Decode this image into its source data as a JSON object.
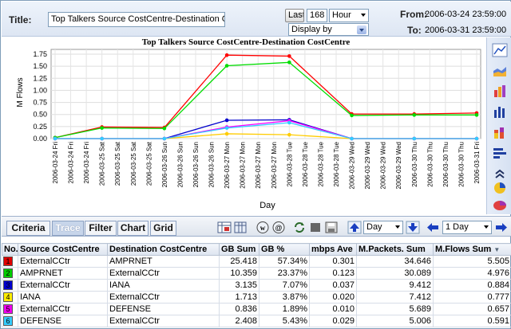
{
  "header": {
    "title_label": "Title:",
    "title_value": "Top Talkers Source CostCentre-Destination CostCentre",
    "last_label": "Last",
    "last_value": "168",
    "unit_value": "Hour",
    "display_by": "Display by",
    "from_label": "From:",
    "from_value": "2006-03-24 23:59:00",
    "to_label": "To:",
    "to_value": "2006-03-31 23:59:00"
  },
  "chart_data": {
    "type": "line",
    "title": "Top Talkers Source CostCentre-Destination CostCentre",
    "xlabel": "Day",
    "ylabel": "M Flows",
    "ylim": [
      0,
      1.75
    ],
    "yticks": [
      "0.00",
      "0.25",
      "0.50",
      "0.75",
      "1.00",
      "1.25",
      "1.50",
      "1.75"
    ],
    "categories": [
      "2006-03-24 Fri",
      "2006-03-24 Fri",
      "2006-03-24 Fri",
      "2006-03-25 Sat",
      "2006-03-25 Sat",
      "2006-03-25 Sat",
      "2006-03-25 Sat",
      "2006-03-26 Sun",
      "2006-03-26 Sun",
      "2006-03-26 Sun",
      "2006-03-26 Sun",
      "2006-03-27 Mon",
      "2006-03-27 Mon",
      "2006-03-27 Mon",
      "2006-03-27 Mon",
      "2006-03-28 Tue",
      "2006-03-28 Tue",
      "2006-03-28 Tue",
      "2006-03-28 Tue",
      "2006-03-29 Wed",
      "2006-03-29 Wed",
      "2006-03-29 Wed",
      "2006-03-29 Wed",
      "2006-03-30 Thu",
      "2006-03-30 Thu",
      "2006-03-30 Thu",
      "2006-03-30 Thu",
      "2006-03-31 Fri"
    ],
    "grid": true,
    "series": [
      {
        "color": "#ff0000",
        "points": [
          [
            0,
            0.02
          ],
          [
            3,
            0.24
          ],
          [
            7,
            0.23
          ],
          [
            11,
            1.73
          ],
          [
            15,
            1.71
          ],
          [
            19,
            0.51
          ],
          [
            23,
            0.51
          ],
          [
            27,
            0.53
          ]
        ]
      },
      {
        "color": "#00dd00",
        "points": [
          [
            0,
            0.02
          ],
          [
            3,
            0.22
          ],
          [
            7,
            0.21
          ],
          [
            11,
            1.51
          ],
          [
            15,
            1.58
          ],
          [
            19,
            0.48
          ],
          [
            23,
            0.49
          ],
          [
            27,
            0.49
          ]
        ]
      },
      {
        "color": "#0000cc",
        "points": [
          [
            0,
            0.0
          ],
          [
            3,
            0.0
          ],
          [
            7,
            0.0
          ],
          [
            11,
            0.38
          ],
          [
            15,
            0.39
          ],
          [
            19,
            0.0
          ],
          [
            23,
            0.0
          ],
          [
            27,
            0.0
          ]
        ]
      },
      {
        "color": "#ffcc00",
        "points": [
          [
            0,
            0.0
          ],
          [
            3,
            0.0
          ],
          [
            7,
            0.0
          ],
          [
            11,
            0.1
          ],
          [
            15,
            0.08
          ],
          [
            19,
            0.0
          ],
          [
            23,
            0.0
          ],
          [
            27,
            0.0
          ]
        ]
      },
      {
        "color": "#ff00ff",
        "points": [
          [
            0,
            0.0
          ],
          [
            3,
            0.0
          ],
          [
            7,
            0.0
          ],
          [
            11,
            0.24
          ],
          [
            15,
            0.37
          ],
          [
            19,
            0.0
          ],
          [
            23,
            0.0
          ],
          [
            27,
            0.0
          ]
        ]
      },
      {
        "color": "#33ccff",
        "points": [
          [
            0,
            0.0
          ],
          [
            3,
            0.0
          ],
          [
            7,
            0.0
          ],
          [
            11,
            0.22
          ],
          [
            15,
            0.33
          ],
          [
            19,
            0.0
          ],
          [
            23,
            0.0
          ],
          [
            27,
            0.0
          ]
        ]
      }
    ]
  },
  "tabs": [
    "Criteria",
    "Trace",
    "Filter",
    "Chart",
    "Grid"
  ],
  "active_tab": "Trace",
  "toolbar": {
    "day_select": "Day",
    "period_select": "1 Day"
  },
  "table": {
    "columns": [
      "No.",
      "Source CostCentre",
      "Destination CostCentre",
      "GB Sum",
      "GB %",
      "mbps Ave",
      "M.Packets. Sum",
      "M.Flows Sum"
    ],
    "rows": [
      {
        "no": "1",
        "color": "#e00000",
        "src": "ExternalCCtr",
        "dst": "AMPRNET",
        "gb": "25.418",
        "pct": "57.34%",
        "mbps": "0.301",
        "pkts": "34.646",
        "flows": "5.505"
      },
      {
        "no": "2",
        "color": "#00cc00",
        "src": "AMPRNET",
        "dst": "ExternalCCtr",
        "gb": "10.359",
        "pct": "23.37%",
        "mbps": "0.123",
        "pkts": "30.089",
        "flows": "4.976"
      },
      {
        "no": "3",
        "color": "#0000cc",
        "src": "ExternalCCtr",
        "dst": "IANA",
        "gb": "3.135",
        "pct": "7.07%",
        "mbps": "0.037",
        "pkts": "9.412",
        "flows": "0.884"
      },
      {
        "no": "4",
        "color": "#ffee00",
        "src": "IANA",
        "dst": "ExternalCCtr",
        "gb": "1.713",
        "pct": "3.87%",
        "mbps": "0.020",
        "pkts": "7.412",
        "flows": "0.777"
      },
      {
        "no": "5",
        "color": "#ee00ee",
        "src": "ExternalCCtr",
        "dst": "DEFENSE",
        "gb": "0.836",
        "pct": "1.89%",
        "mbps": "0.010",
        "pkts": "5.689",
        "flows": "0.657"
      },
      {
        "no": "6",
        "color": "#33ccff",
        "src": "DEFENSE",
        "dst": "ExternalCCtr",
        "gb": "2.408",
        "pct": "5.43%",
        "mbps": "0.029",
        "pkts": "5.006",
        "flows": "0.591"
      }
    ]
  }
}
